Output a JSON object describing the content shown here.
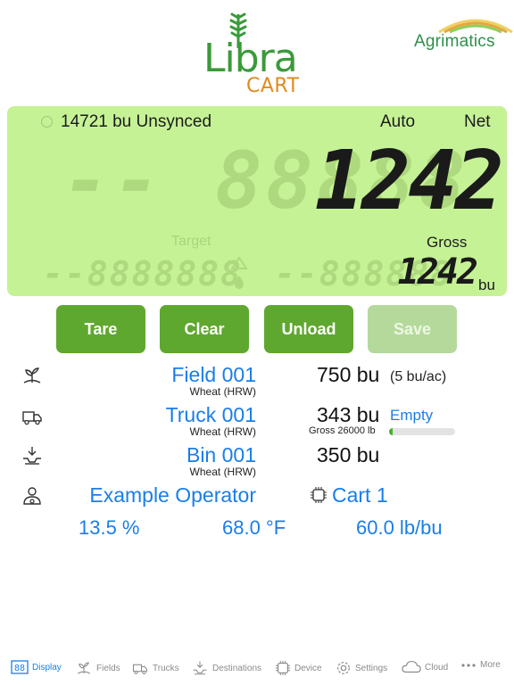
{
  "header": {
    "libra_word": "Libra",
    "cart_word": "CART",
    "agrimatics_word": "Agrimatics"
  },
  "display": {
    "unsynced_text": "14721 bu Unsynced",
    "mode_auto": "Auto",
    "mode_net": "Net",
    "ghost_big": "-- 88888",
    "main_weight": "1242",
    "target_label": "Target",
    "gross_label": "Gross",
    "gross_value": "1242",
    "gross_unit": "bu",
    "ghost_small_left": "--8888888",
    "ghost_small_right": "--888888"
  },
  "buttons": {
    "tare": "Tare",
    "clear": "Clear",
    "unload": "Unload",
    "save": "Save"
  },
  "field": {
    "name": "Field 001",
    "crop": "Wheat (HRW)",
    "amount": "750 bu",
    "rate": "(5 bu/ac)"
  },
  "truck": {
    "name": "Truck 001",
    "crop": "Wheat (HRW)",
    "amount": "343 bu",
    "status": "Empty",
    "gross": "Gross 26000 lb",
    "fill_percent": 6
  },
  "bin": {
    "name": "Bin 001",
    "crop": "Wheat (HRW)",
    "amount": "350 bu"
  },
  "operator": {
    "name": "Example Operator",
    "cart": "Cart 1"
  },
  "metrics": {
    "moisture": "13.5 %",
    "temperature": "68.0 °F",
    "test_weight": "60.0 lb/bu"
  },
  "tabs": [
    {
      "label": "Display",
      "icon": "display-icon",
      "active": true
    },
    {
      "label": "Fields",
      "icon": "fields-icon"
    },
    {
      "label": "Trucks",
      "icon": "trucks-icon"
    },
    {
      "label": "Destinations",
      "icon": "destinations-icon"
    },
    {
      "label": "Device",
      "icon": "device-icon"
    },
    {
      "label": "Settings",
      "icon": "settings-icon"
    },
    {
      "label": "Cloud",
      "icon": "cloud-icon"
    },
    {
      "label": "More",
      "icon": "more-icon"
    }
  ],
  "colors": {
    "panel": "#c6f296",
    "button": "#5fa82f",
    "button_disabled": "#b5d99b",
    "accent_blue": "#1a7ee8",
    "logo_green": "#3a9a3a",
    "logo_orange": "#e08a1e"
  }
}
